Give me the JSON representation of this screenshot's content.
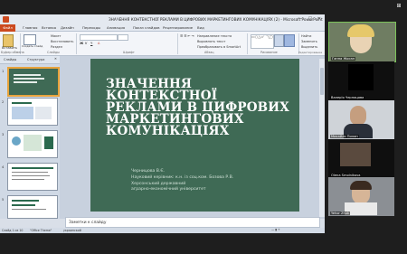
{
  "window": {
    "title": "ЗНАЧЕННЯ КОНТЕКСТНОЇ РЕКЛАМИ В ЦИФРОВИХ МАРКЕТИНГОВИХ КОМУНІКАЦІЯХ (2) - Microsoft PowerPoint"
  },
  "ribbon": {
    "tabs": [
      "Файл",
      "Главная",
      "Вставка",
      "Дизайн",
      "Переходы",
      "Анимация",
      "Показ слайдов",
      "Рецензирование",
      "Вид"
    ],
    "groups": [
      "Буфер обмена",
      "Слайды",
      "Шрифт",
      "Абзац",
      "Рисование",
      "Редактирование"
    ],
    "buttons": {
      "paste": "Вставить",
      "new_slide": "Создать слайд",
      "layout": "Макет",
      "reset": "Восстановить",
      "section": "Раздел",
      "text_direction": "Направление текста",
      "align_text": "Выровнять текст",
      "smartart": "Преобразовать в SmartArt",
      "arrange": "Упорядочить",
      "quick_styles": "Экспресс-стили",
      "find": "Найти",
      "replace": "Заменить",
      "select": "Выделить"
    }
  },
  "panel": {
    "tab1": "Слайды",
    "tab2": "Структура",
    "slide_numbers": [
      "1",
      "2",
      "3",
      "4",
      "5"
    ]
  },
  "slide": {
    "title": "ЗНАЧЕННЯ КОНТЕКСТНОЇ РЕКЛАМИ В ЦИФРОВИХ МАРКЕТИНГОВИХ КОМУНІКАЦІЯХ",
    "author": "Черницова В.Є.",
    "supervisor": "Науковий керівник: к.н. із соц.ком. Бозова Р.В.",
    "uni1": "Херсонський державний",
    "uni2": "аграрно-економічний університет"
  },
  "notes": {
    "placeholder": "Заметки к слайду"
  },
  "status": {
    "slide": "Слайд 1 из 10",
    "theme": "\"Office Theme\"",
    "lang": "украинский"
  },
  "participants": [
    {
      "name": "Ганна Жосан",
      "accent": "#7cc25a"
    },
    {
      "name": "Валерія Черницова",
      "accent": "#1e1e1e"
    },
    {
      "name": "Михайло Пилип",
      "accent": "#1e1e1e"
    },
    {
      "name": "Olena Smolnikova",
      "accent": "#1e1e1e"
    },
    {
      "name": "Yehor Zhuk",
      "accent": "#1e1e1e"
    }
  ],
  "colors": {
    "slide_bg": "#3f6a55",
    "slide_text": "#ffffff",
    "file_tab": "#cc4a1f"
  }
}
